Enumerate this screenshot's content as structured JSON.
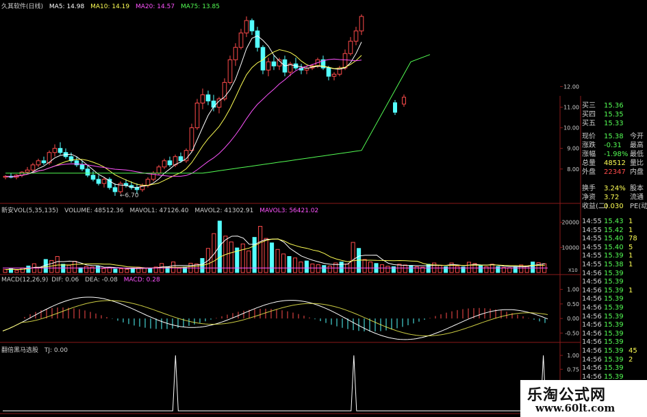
{
  "colors": {
    "up": "#ff4b4b",
    "down": "#54ffff",
    "ma5": "#ffffff",
    "ma10": "#ffff54",
    "ma20": "#ff54ff",
    "ma75": "#54ff54",
    "frame": "#8b1a1a",
    "text": "#cfcfcf"
  },
  "price_header": {
    "name": "久其软件(日线)",
    "ma5": "MA5: 14.98",
    "ma10": "MA10: 14.19",
    "ma20": "MA20: 14.57",
    "ma75": "MA75: 13.85"
  },
  "price_axis": {
    "ticks": [
      "12.00",
      "11.00",
      "10.00",
      "9.00",
      "8.00"
    ]
  },
  "low_label": "←6.70",
  "volume_header": {
    "title": "新安VOL(5,35,135)",
    "volume": "VOLUME: 48512.36",
    "mavol1": "MAVOL1: 47126.40",
    "mavol2": "MAVOL2: 41302.91",
    "mavol3": "MAVOL3: 56421.02"
  },
  "volume_axis": {
    "ticks": [
      "20000",
      "10000"
    ],
    "unit": "X10"
  },
  "macd_header": {
    "title": "MACD(12,26,9)",
    "dif": "DIF: 0.06",
    "dea": "DEA: -0.08",
    "macd": "MACD: 0.28"
  },
  "macd_axis": {
    "ticks": [
      "1.00",
      "0.50",
      "0.00",
      "-0.50"
    ]
  },
  "tj_header": {
    "title": "翻倍黑马选股",
    "tj": "TJ: 0.00"
  },
  "tj_axis": {
    "ticks": [
      "1.00",
      "0.75",
      "0.50"
    ]
  },
  "quote_panel": {
    "bids": [
      {
        "label": "买三",
        "price": "15.36"
      },
      {
        "label": "买四",
        "price": "15.35"
      },
      {
        "label": "买五",
        "price": "15.33"
      }
    ],
    "stats": [
      {
        "l1": "现价",
        "v1": "15.38",
        "l2": "今开"
      },
      {
        "l1": "涨跌",
        "v1": "-0.31",
        "l2": "最高"
      },
      {
        "l1": "涨幅",
        "v1": "-1.98%",
        "l2": "最低"
      },
      {
        "l1": "总量",
        "v1": "48512",
        "l2": "量比"
      },
      {
        "l1": "外盘",
        "v1": "22347",
        "l2": "内盘"
      }
    ],
    "stats2": [
      {
        "l1": "换手",
        "v1": "3.24%",
        "l2": "股本"
      },
      {
        "l1": "净资",
        "v1": "3.72",
        "l2": "流通"
      },
      {
        "l1": "收益(二)",
        "v1": "0.030",
        "l2": "PE(动)"
      }
    ],
    "ticks": [
      {
        "time": "14:55",
        "price": "15.43",
        "vol": "1"
      },
      {
        "time": "14:55",
        "price": "15.42",
        "vol": "1"
      },
      {
        "time": "14:55",
        "price": "15.40",
        "vol": "78"
      },
      {
        "time": "14:55",
        "price": "15.40",
        "vol": "5"
      },
      {
        "time": "14:55",
        "price": "15.39",
        "vol": "1"
      },
      {
        "time": "14:55",
        "price": "15.38",
        "vol": "1"
      },
      {
        "time": "14:56",
        "price": "15.39",
        "vol": ""
      },
      {
        "time": "14:56",
        "price": "15.39",
        "vol": ""
      },
      {
        "time": "14:56",
        "price": "15.39",
        "vol": "1"
      },
      {
        "time": "14:56",
        "price": "15.39",
        "vol": ""
      },
      {
        "time": "14:56",
        "price": "15.39",
        "vol": ""
      },
      {
        "time": "14:56",
        "price": "15.39",
        "vol": ""
      },
      {
        "time": "14:56",
        "price": "15.39",
        "vol": ""
      },
      {
        "time": "14:56",
        "price": "15.39",
        "vol": ""
      },
      {
        "time": "14:56",
        "price": "15.39",
        "vol": ""
      },
      {
        "time": "14:56",
        "price": "15.39",
        "vol": "45"
      },
      {
        "time": "14:56",
        "price": "15.39",
        "vol": "2"
      },
      {
        "time": "14:56",
        "price": "15.39",
        "vol": ""
      },
      {
        "time": "14:56",
        "price": "15.39",
        "vol": ""
      }
    ]
  },
  "watermark": {
    "title": "乐淘公式网",
    "url": "www.60lt.com"
  },
  "chart_data": [
    {
      "type": "candlestick",
      "title": "久其软件(日线)",
      "ylim": [
        6.5,
        15.6
      ],
      "candles": [
        [
          7.6,
          7.7,
          7.5,
          7.65
        ],
        [
          7.65,
          7.8,
          7.55,
          7.6
        ],
        [
          7.6,
          7.75,
          7.5,
          7.7
        ],
        [
          7.7,
          7.9,
          7.6,
          7.85
        ],
        [
          7.85,
          8.1,
          7.75,
          7.95
        ],
        [
          7.95,
          8.3,
          7.85,
          8.2
        ],
        [
          8.2,
          8.5,
          8.1,
          8.4
        ],
        [
          8.4,
          8.6,
          8.2,
          8.3
        ],
        [
          8.3,
          8.9,
          8.2,
          8.8
        ],
        [
          8.8,
          9.2,
          8.6,
          9.0
        ],
        [
          9.0,
          9.3,
          8.7,
          8.8
        ],
        [
          8.8,
          9.0,
          8.5,
          8.6
        ],
        [
          8.6,
          8.8,
          8.3,
          8.4
        ],
        [
          8.4,
          8.6,
          8.1,
          8.2
        ],
        [
          8.2,
          8.4,
          7.9,
          8.0
        ],
        [
          8.0,
          8.2,
          7.6,
          7.7
        ],
        [
          7.7,
          7.9,
          7.4,
          7.5
        ],
        [
          7.5,
          7.7,
          7.2,
          7.3
        ],
        [
          7.3,
          7.6,
          7.1,
          7.5
        ],
        [
          7.5,
          7.6,
          7.0,
          7.1
        ],
        [
          7.1,
          7.3,
          6.7,
          6.9
        ],
        [
          6.9,
          7.4,
          6.8,
          7.3
        ],
        [
          7.3,
          7.5,
          7.1,
          7.2
        ],
        [
          7.2,
          7.4,
          7.0,
          7.1
        ],
        [
          7.1,
          7.3,
          6.8,
          7.0
        ],
        [
          7.0,
          7.3,
          6.9,
          7.2
        ],
        [
          7.2,
          7.6,
          7.1,
          7.5
        ],
        [
          7.5,
          7.9,
          7.4,
          7.8
        ],
        [
          7.8,
          8.2,
          7.7,
          8.1
        ],
        [
          8.1,
          8.5,
          8.0,
          8.4
        ],
        [
          8.4,
          8.6,
          8.1,
          8.2
        ],
        [
          8.2,
          8.7,
          8.1,
          8.6
        ],
        [
          8.6,
          8.8,
          8.3,
          8.4
        ],
        [
          8.4,
          9.0,
          8.3,
          8.9
        ],
        [
          8.9,
          10.2,
          8.8,
          10.0
        ],
        [
          10.0,
          11.4,
          9.9,
          11.2
        ],
        [
          11.2,
          11.9,
          10.9,
          11.6
        ],
        [
          11.6,
          11.8,
          11.1,
          11.3
        ],
        [
          11.3,
          11.6,
          10.8,
          11.0
        ],
        [
          11.0,
          11.5,
          10.7,
          11.4
        ],
        [
          11.4,
          12.4,
          11.3,
          12.2
        ],
        [
          12.2,
          13.5,
          12.1,
          13.3
        ],
        [
          13.3,
          14.1,
          13.0,
          13.9
        ],
        [
          13.9,
          14.8,
          13.8,
          14.6
        ],
        [
          14.6,
          15.4,
          14.4,
          15.2
        ],
        [
          15.2,
          15.3,
          14.5,
          14.7
        ],
        [
          14.7,
          14.9,
          13.7,
          13.9
        ],
        [
          13.9,
          14.0,
          12.6,
          12.8
        ],
        [
          12.8,
          13.4,
          12.5,
          13.2
        ],
        [
          13.2,
          13.5,
          12.8,
          13.0
        ],
        [
          13.0,
          13.4,
          12.8,
          13.3
        ],
        [
          13.3,
          13.5,
          12.5,
          12.7
        ],
        [
          12.7,
          13.2,
          12.5,
          13.1
        ],
        [
          13.1,
          13.4,
          12.8,
          12.9
        ],
        [
          12.9,
          13.1,
          12.6,
          12.8
        ],
        [
          12.8,
          13.0,
          12.6,
          12.9
        ],
        [
          12.9,
          13.1,
          12.8,
          13.0
        ],
        [
          13.0,
          13.4,
          12.9,
          13.3
        ],
        [
          13.3,
          13.5,
          12.8,
          12.9
        ],
        [
          12.9,
          13.0,
          12.3,
          12.5
        ],
        [
          12.5,
          12.7,
          12.3,
          12.6
        ],
        [
          12.6,
          13.0,
          12.5,
          12.9
        ],
        [
          12.9,
          13.8,
          12.8,
          13.6
        ],
        [
          13.6,
          14.4,
          13.5,
          14.2
        ],
        [
          14.2,
          14.9,
          14.0,
          14.7
        ],
        [
          14.7,
          15.5,
          14.5,
          15.4
        ]
      ],
      "ma_lines": [
        "MA5",
        "MA10",
        "MA20",
        "MA75"
      ]
    },
    {
      "type": "bar",
      "title": "新安VOL(5,35,135)",
      "ylim": [
        0,
        24000
      ],
      "values": [
        1200,
        1500,
        900,
        1800,
        2600,
        3500,
        2000,
        5200,
        4800,
        6400,
        3300,
        2900,
        4500,
        1900,
        2400,
        2200,
        2600,
        1600,
        2000,
        1400,
        1500,
        1300,
        1800,
        2100,
        1700,
        1600,
        2200,
        3600,
        2300,
        4200,
        1700,
        2200,
        3700,
        3400,
        5600,
        9600,
        15500,
        20500,
        14500,
        12200,
        9800,
        11400,
        8600,
        14000,
        18400,
        13600,
        11800,
        9200,
        7400,
        6400,
        5800,
        4200,
        4600,
        3400,
        3100,
        2800,
        2600,
        3800,
        4200,
        3400,
        12000,
        9600,
        5200,
        4200,
        3600,
        3100,
        2500,
        2300,
        3300,
        3000,
        2800,
        2300,
        2100,
        3300,
        3800,
        2800,
        2300,
        3800,
        2500,
        2200,
        4100,
        3600,
        2700,
        2300,
        3300,
        2400,
        2000,
        1900,
        2200,
        3000,
        2600,
        4200,
        3900,
        3500
      ]
    },
    {
      "type": "line",
      "title": "MACD(12,26,9)",
      "ylim": [
        -0.75,
        1.25
      ]
    },
    {
      "type": "line",
      "title": "翻倍黑马选股",
      "ylim": [
        0,
        1.05
      ],
      "spikes_at_fraction": [
        0.31,
        0.63,
        0.97
      ]
    }
  ]
}
